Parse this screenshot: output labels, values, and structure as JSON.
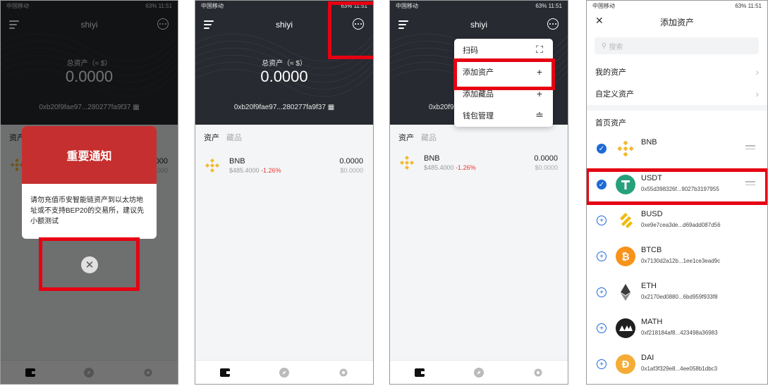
{
  "status": {
    "carrier": "中国移动",
    "battery": "63%",
    "time": "11:51"
  },
  "wallet": {
    "name": "shiyi",
    "total_label": "总资产（≈ $）",
    "total_value": "0.0000",
    "address": "0xb20f9fae97...280277fa9f37"
  },
  "tabs": {
    "assets": "资产",
    "collectibles": "藏品"
  },
  "asset_bnb": {
    "name": "BNB",
    "price": "$485.4000",
    "change": "-1.26%",
    "balance": "0.0000",
    "value": "$0.0000"
  },
  "notice": {
    "title": "重要通知",
    "body": "请勿充值币安智能链资产到以太坊地址或不支持BEP20的交易所，建议先小额测试",
    "close_glyph": "✕",
    "partial_balance_1": "000",
    "partial_balance_2": "000"
  },
  "dropdown": {
    "items": [
      {
        "label": "扫码",
        "icon": "scan-icon"
      },
      {
        "label": "添加资产",
        "icon": "plus-icon"
      },
      {
        "label": "添加藏品",
        "icon": "plus-icon"
      },
      {
        "label": "钱包管理",
        "icon": "sliders-icon"
      }
    ]
  },
  "add_asset": {
    "title": "添加资产",
    "search_placeholder": "搜索",
    "my_assets": "我的资产",
    "custom_assets": "自定义资产",
    "section_title": "首页资产",
    "tokens": [
      {
        "name": "BNB",
        "address": "",
        "selected": true,
        "color": "#f3ba2f"
      },
      {
        "name": "USDT",
        "address": "0x55d398326f...9027b3197955",
        "selected": true,
        "color": "#26a17b"
      },
      {
        "name": "BUSD",
        "address": "0xe9e7cea3de...d69add087d56",
        "selected": false,
        "color": "#f0b90b"
      },
      {
        "name": "BTCB",
        "address": "0x7130d2a12b...1ee1ce3ead9c",
        "selected": false,
        "color": "#f7931a"
      },
      {
        "name": "ETH",
        "address": "0x2170ed0880...6bd959f933f8",
        "selected": false,
        "color": "#3c3c3d"
      },
      {
        "name": "MATH",
        "address": "0xf218184af8...423498a36983",
        "selected": false,
        "color": "#1f1f1f"
      },
      {
        "name": "DAI",
        "address": "0x1af3f329e8...4ee058b1dbc3",
        "selected": false,
        "color": "#f5ac37"
      }
    ]
  },
  "colors": {
    "highlight": "#e60012",
    "notice_red": "#c62f2f",
    "hero_dark": "#272a30",
    "negative": "#e53935",
    "check_blue": "#1e6ad6"
  }
}
